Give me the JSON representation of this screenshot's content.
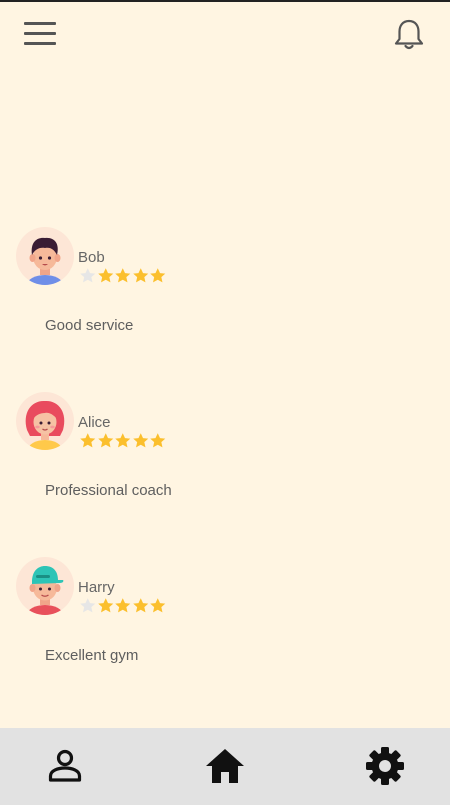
{
  "header": {
    "menu_icon": "menu-icon",
    "notification_icon": "bell-icon"
  },
  "reviews": [
    {
      "name": "Bob",
      "rating": 4,
      "max_rating": 5,
      "comment": "Good service",
      "avatar_icon": "boy-avatar"
    },
    {
      "name": "Alice",
      "rating": 5,
      "max_rating": 5,
      "comment": "Professional coach",
      "avatar_icon": "girl-avatar"
    },
    {
      "name": "Harry",
      "rating": 4,
      "max_rating": 5,
      "comment": "Excellent gym",
      "avatar_icon": "cap-boy-avatar"
    }
  ],
  "bottom_nav": {
    "items": [
      {
        "icon": "person-icon"
      },
      {
        "icon": "home-icon"
      },
      {
        "icon": "gear-icon"
      }
    ]
  },
  "colors": {
    "background": "#fff5e2",
    "star_filled": "#fbbf2d",
    "star_empty": "#e6e6e6",
    "nav_background": "#e2e2e2"
  }
}
